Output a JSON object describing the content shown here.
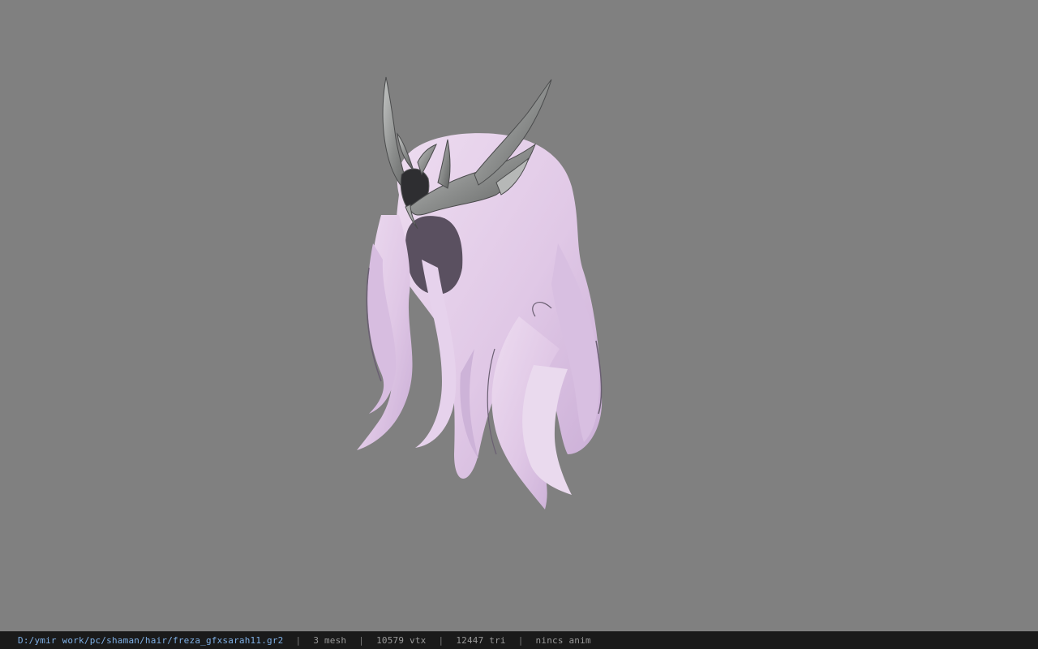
{
  "viewport": {
    "background": "#808080",
    "model": {
      "hair_color": "#e0c8e6",
      "hair_shadow": "#4f4656",
      "crown_color": "#9ea09f",
      "crown_dark": "#2a2a2c"
    }
  },
  "statusbar": {
    "file_path": "D:/ymir work/pc/shaman/hair/freza_gfxsarah11.gr2",
    "mesh": "3 mesh",
    "vertices": "10579 vtx",
    "triangles": "12447 tri",
    "anim": "nincs anim",
    "separator": "|"
  }
}
